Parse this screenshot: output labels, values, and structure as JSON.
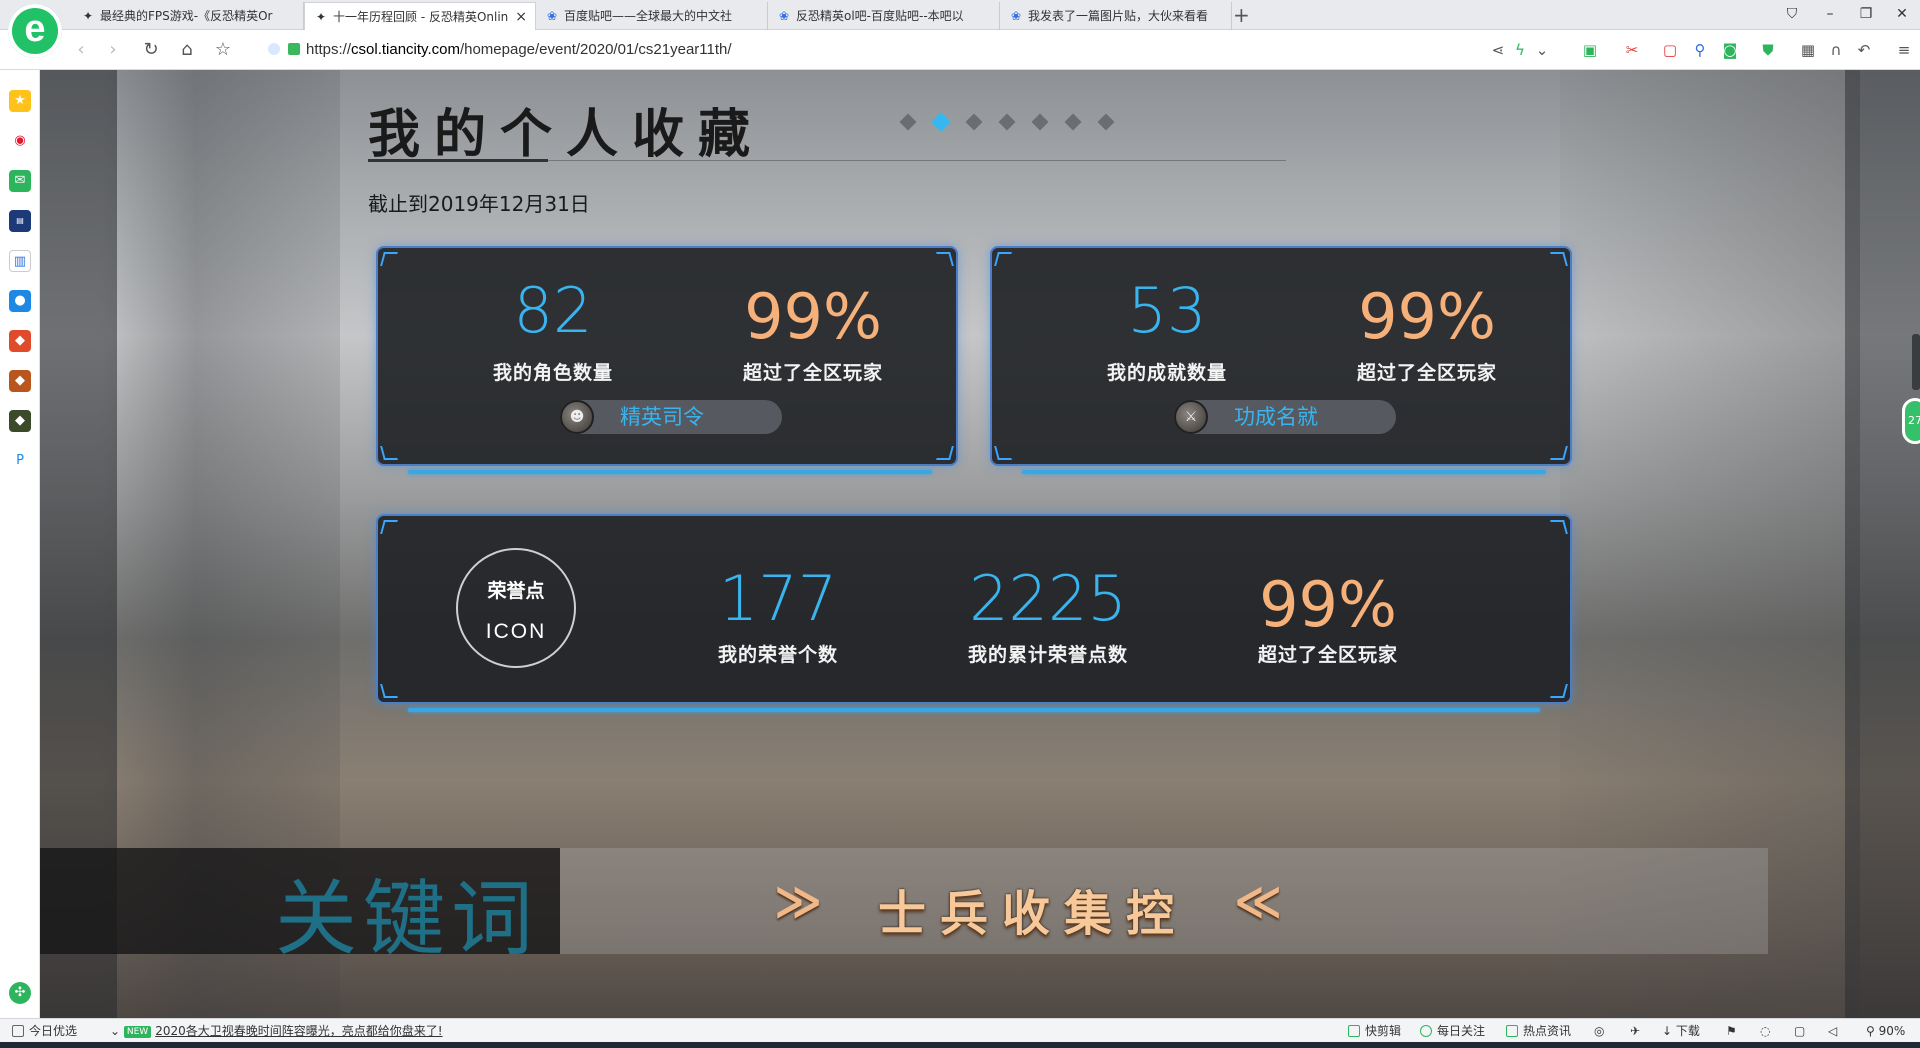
{
  "browser": {
    "tabs": [
      {
        "title": "最经典的FPS游戏-《反恐精英Or",
        "icon": "cs-icon",
        "active": false
      },
      {
        "title": "十一年历程回顾 - 反恐精英Onlin",
        "icon": "cs-icon",
        "active": true
      },
      {
        "title": "百度贴吧——全球最大的中文社",
        "icon": "paw-icon",
        "active": false
      },
      {
        "title": "反恐精英ol吧-百度贴吧--本吧以",
        "icon": "paw-icon",
        "active": false
      },
      {
        "title": "我发表了一篇图片贴，大伙来看看",
        "icon": "paw-icon",
        "active": false
      }
    ],
    "url_prefix": "https://",
    "url_domain": "csol.tiancity.com",
    "url_path": "/homepage/event/2020/01/cs21year11th/",
    "brand_color": "#21c267"
  },
  "page": {
    "title": "我的个人收藏",
    "date_note": "截止到2019年12月31日",
    "pager_dots": 7,
    "pager_active": 1,
    "card_roles": {
      "count": "82",
      "count_label": "我的角色数量",
      "percent": "99%",
      "percent_label": "超过了全区玩家",
      "badge": "精英司令"
    },
    "card_achievements": {
      "count": "53",
      "count_label": "我的成就数量",
      "percent": "99%",
      "percent_label": "超过了全区玩家",
      "badge": "功成名就"
    },
    "card_honor": {
      "icon_line1": "荣誉点",
      "icon_line2": "ICON",
      "honor_count": "177",
      "honor_count_label": "我的荣誉个数",
      "honor_points": "2225",
      "honor_points_label": "我的累计荣誉点数",
      "percent": "99%",
      "percent_label": "超过了全区玩家"
    },
    "keyword": {
      "label": "关键词",
      "value": "士兵收集控",
      "left_chevron": "≫",
      "right_chevron": "≪"
    },
    "accent_blue": "#39b4ef",
    "accent_orange": "#f6b07a"
  },
  "statusbar": {
    "left_label": "今日优选",
    "news_badge": "NEW",
    "news": "2020各大卫视春晚时间阵容曝光，亮点都给你盘来了!",
    "quick_clip": "快剪辑",
    "daily": "每日关注",
    "hot": "热点资讯",
    "download": "下载",
    "zoom": "90%"
  }
}
